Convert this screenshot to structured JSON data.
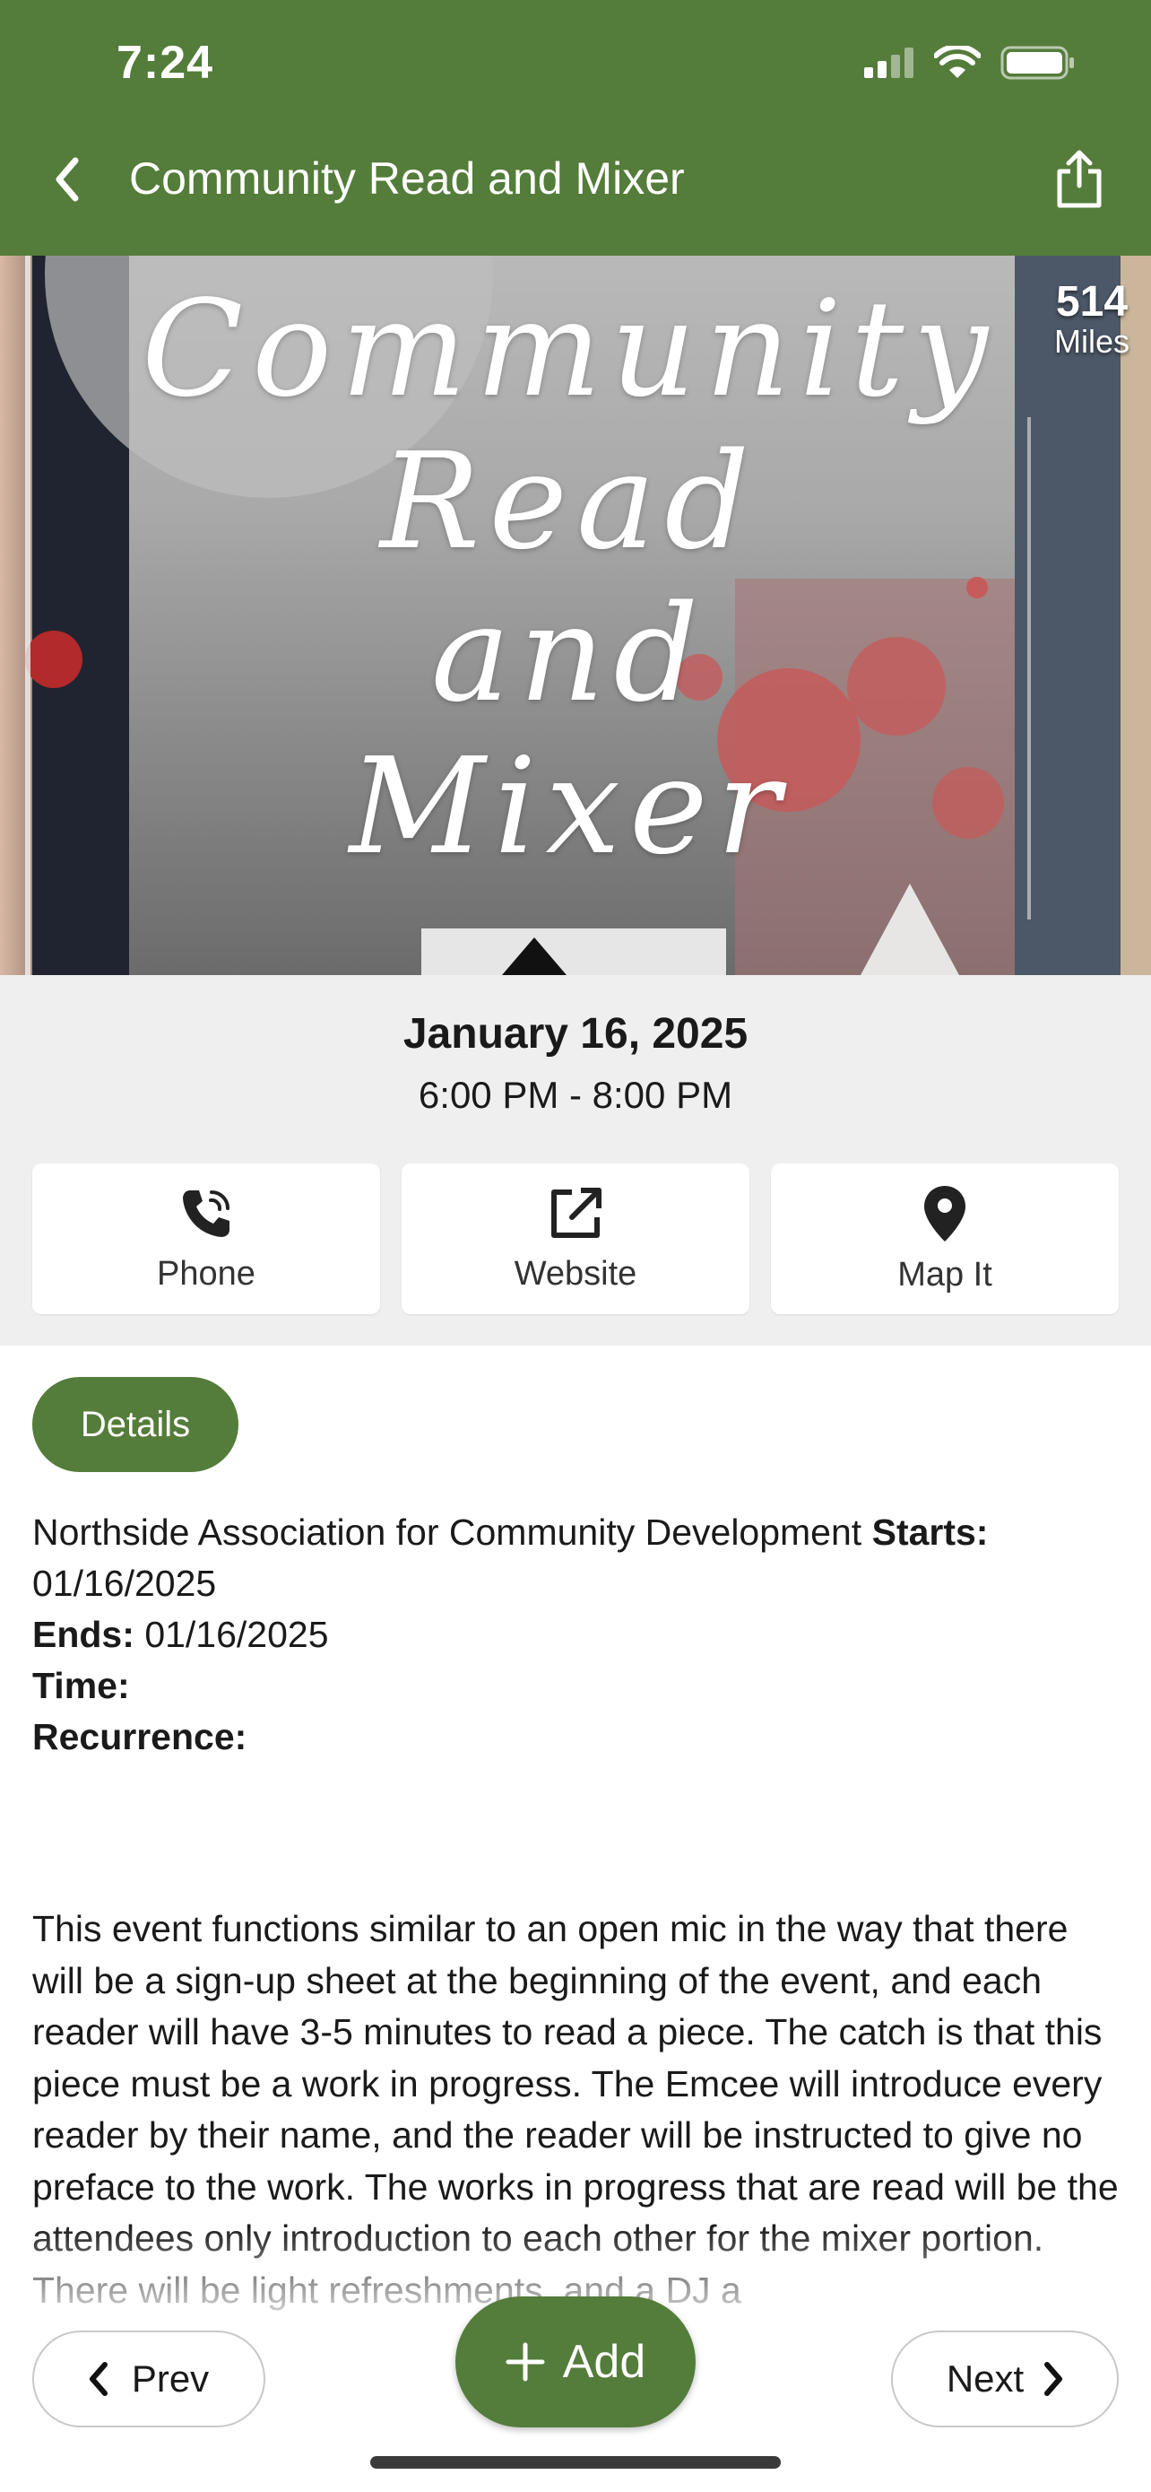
{
  "status_bar": {
    "time": "7:24"
  },
  "nav": {
    "title": "Community Read and Mixer"
  },
  "hero": {
    "poster_lines": [
      "Community",
      "Read",
      "and",
      "Mixer"
    ],
    "distance_value": "514",
    "distance_unit": "Miles"
  },
  "event": {
    "date": "January 16, 2025",
    "time_range": "6:00 PM - 8:00 PM"
  },
  "actions": [
    {
      "label": "Phone",
      "icon": "phone-icon"
    },
    {
      "label": "Website",
      "icon": "external-link-icon"
    },
    {
      "label": "Map It",
      "icon": "map-pin-icon"
    }
  ],
  "details_tab": {
    "label": "Details"
  },
  "details": {
    "organizer": "Northside Association for Community Development",
    "starts_label": "Starts:",
    "starts_value": "01/16/2025",
    "ends_label": "Ends:",
    "ends_value": "01/16/2025",
    "time_label": "Time:",
    "recurrence_label": "Recurrence:",
    "description": "This event functions similar to an open mic in the way that there will be a sign-up sheet at the beginning of the event, and each reader will have 3-5 minutes to read a piece. The catch is that this piece must be a work in progress. The Emcee will introduce every reader by their name, and the reader will be instructed to give no preface to the work. The works in progress that are read will be the attendees only introduction to each other for the mixer portion. There will be light refreshments, and a DJ a"
  },
  "bottom_bar": {
    "prev_label": "Prev",
    "add_label": "Add",
    "next_label": "Next"
  },
  "colors": {
    "brand_green": "#547c3a",
    "info_background": "#efeff0"
  }
}
